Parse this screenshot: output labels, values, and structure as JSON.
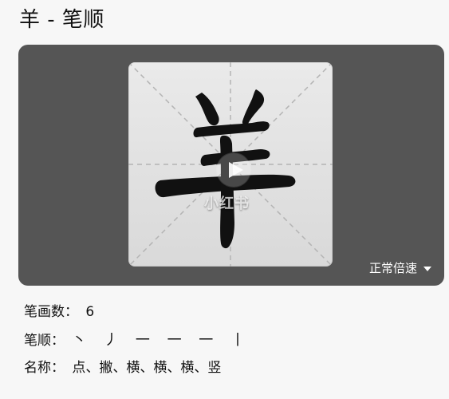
{
  "title": "羊 - 笔顺",
  "player": {
    "watermark": "小红书",
    "speed_label": "正常倍速"
  },
  "info": {
    "stroke_count_label": "笔画数：",
    "stroke_count_value": "6",
    "stroke_order_label": "笔顺：",
    "stroke_order_value": "丶 丿 一 一 一 丨",
    "names_label": "名称：",
    "names_value": "点、撇、横、横、横、竖"
  },
  "icons": {
    "play": "play-icon",
    "dropdown": "chevron-down-icon"
  },
  "colors": {
    "background": "#f7f7f7",
    "card": "#555555",
    "text": "#111111"
  }
}
